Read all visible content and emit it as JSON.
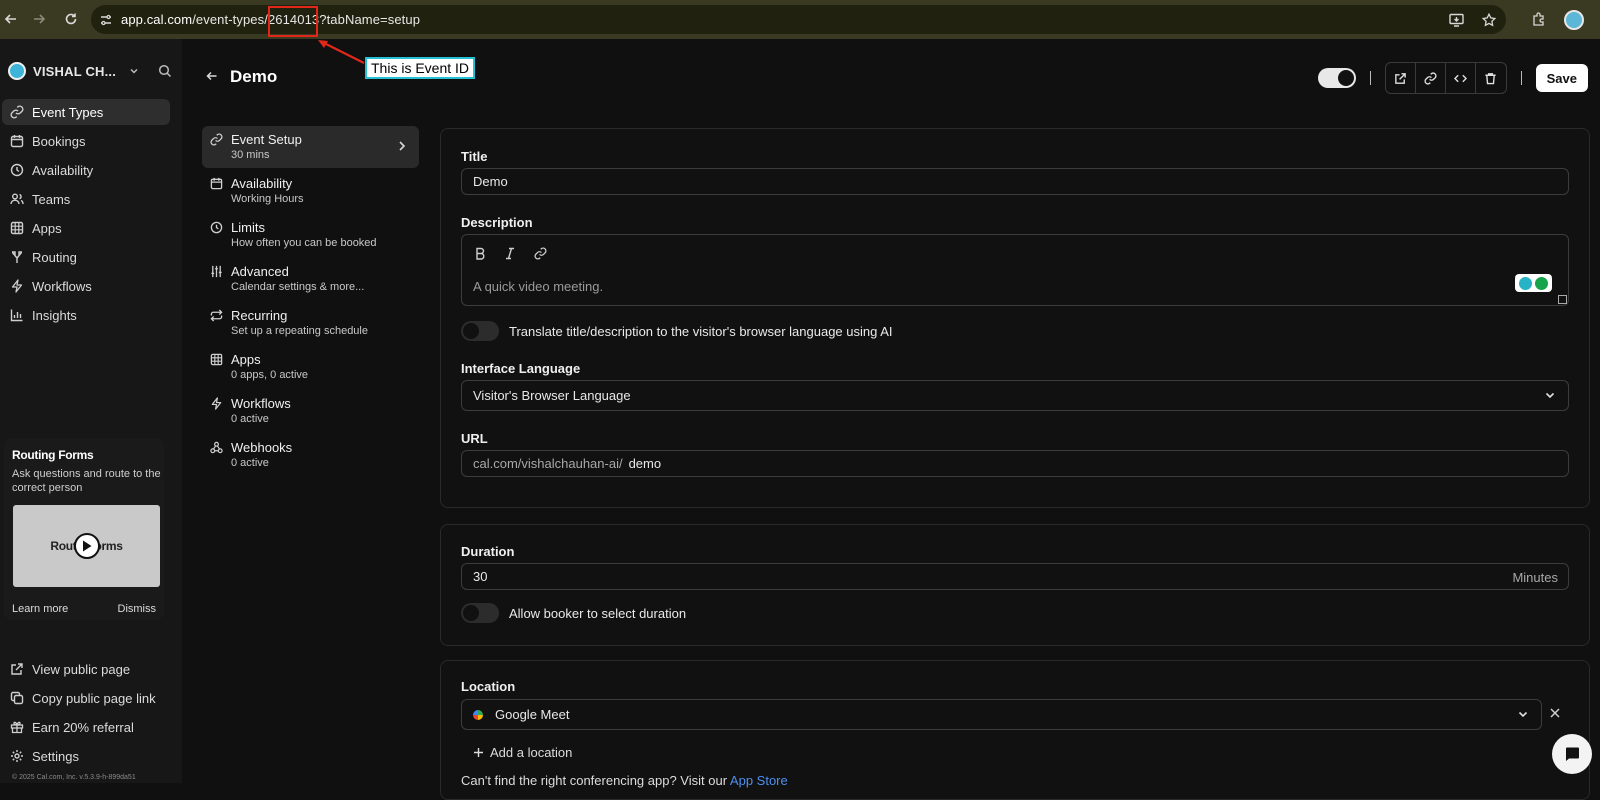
{
  "browser": {
    "url_host": "app.cal.com",
    "url_path_before": "/event-types/",
    "url_event_id": "2614013",
    "url_query": "?tabName=setup"
  },
  "annotation": {
    "label": "This is Event ID",
    "box_color": "#e0271a",
    "label_border_color": "#23c1d3"
  },
  "sidebar": {
    "user_name": "VISHAL CH...",
    "nav": [
      {
        "label": "Event Types",
        "icon": "link-icon",
        "active": true
      },
      {
        "label": "Bookings",
        "icon": "calendar-icon"
      },
      {
        "label": "Availability",
        "icon": "clock-icon"
      },
      {
        "label": "Teams",
        "icon": "users-icon"
      },
      {
        "label": "Apps",
        "icon": "grid-icon"
      },
      {
        "label": "Routing",
        "icon": "split-icon"
      },
      {
        "label": "Workflows",
        "icon": "zap-icon"
      },
      {
        "label": "Insights",
        "icon": "bar-chart-icon"
      }
    ],
    "promo": {
      "title": "Routing Forms",
      "description": "Ask questions and route to the correct person",
      "thumb_text_left": "Rout",
      "thumb_text_right": "orms",
      "learn_more": "Learn more",
      "dismiss": "Dismiss"
    },
    "footer": [
      {
        "label": "View public page",
        "icon": "external-link-icon"
      },
      {
        "label": "Copy public page link",
        "icon": "copy-icon"
      },
      {
        "label": "Earn 20% referral",
        "icon": "gift-icon"
      },
      {
        "label": "Settings",
        "icon": "gear-icon"
      }
    ],
    "copyright": "© 2025 Cal.com, Inc. v.5.3.9-h-899da51"
  },
  "header": {
    "title": "Demo",
    "save_label": "Save",
    "hidden_toggle_on": true
  },
  "tabs": [
    {
      "label": "Event Setup",
      "sub": "30 mins",
      "icon": "link-icon",
      "active": true
    },
    {
      "label": "Availability",
      "sub": "Working Hours",
      "icon": "calendar-icon"
    },
    {
      "label": "Limits",
      "sub": "How often you can be booked",
      "icon": "clock-icon"
    },
    {
      "label": "Advanced",
      "sub": "Calendar settings & more...",
      "icon": "sliders-icon"
    },
    {
      "label": "Recurring",
      "sub": "Set up a repeating schedule",
      "icon": "repeat-icon"
    },
    {
      "label": "Apps",
      "sub": "0 apps, 0 active",
      "icon": "grid-icon"
    },
    {
      "label": "Workflows",
      "sub": "0 active",
      "icon": "zap-icon"
    },
    {
      "label": "Webhooks",
      "sub": "0 active",
      "icon": "webhook-icon"
    }
  ],
  "form": {
    "title_label": "Title",
    "title_value": "Demo",
    "description_label": "Description",
    "description_placeholder": "A quick video meeting.",
    "translate_label": "Translate title/description to the visitor's browser language using AI",
    "interface_language_label": "Interface Language",
    "interface_language_value": "Visitor's Browser Language",
    "url_label": "URL",
    "url_prefix": "cal.com/vishalchauhan-ai/",
    "url_slug": "demo",
    "duration_label": "Duration",
    "duration_value": "30",
    "duration_suffix": "Minutes",
    "allow_duration_label": "Allow booker to select duration",
    "location_label": "Location",
    "location_value": "Google Meet",
    "add_location": "Add a location",
    "cant_find_text": "Can't find the right conferencing app? Visit our ",
    "app_store_link": "App Store"
  }
}
